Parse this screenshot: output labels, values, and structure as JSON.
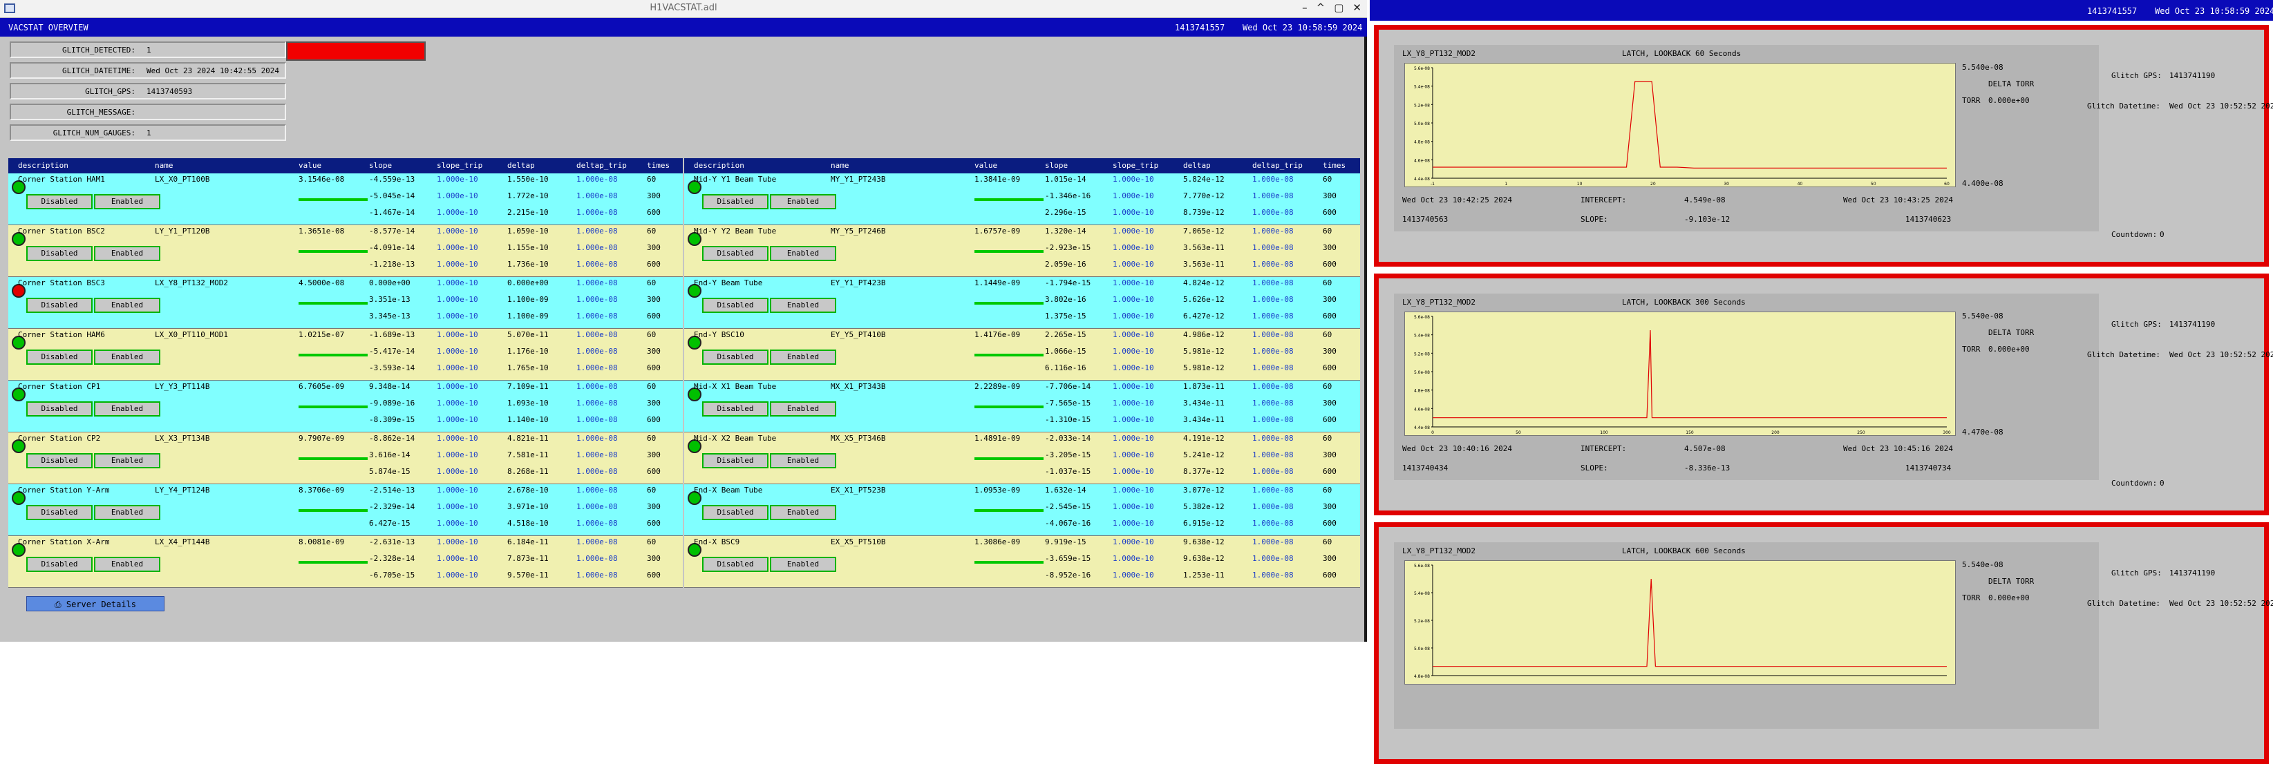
{
  "window": {
    "title": "H1VACSTAT.adl",
    "controls": [
      "–",
      "^",
      "▢",
      "✕"
    ]
  },
  "header": {
    "title": "VACSTAT OVERVIEW",
    "gps": "1413741557",
    "datetime": "Wed Oct 23 10:58:59 2024"
  },
  "right_header": {
    "gps": "1413741557",
    "datetime": "Wed Oct 23 10:58:59 2024"
  },
  "glitch": {
    "detected_label": "GLITCH_DETECTED:",
    "detected_value": "1",
    "datetime_label": "GLITCH_DATETIME:",
    "datetime_value": "Wed Oct 23 2024 10:42:55 2024",
    "gps_label": "GLITCH_GPS:",
    "gps_value": "1413740593",
    "message_label": "GLITCH_MESSAGE:",
    "message_value": "",
    "num_gauges_label": "GLITCH_NUM_GAUGES:",
    "num_gauges_value": "1"
  },
  "columns": [
    "description",
    "name",
    "value",
    "slope",
    "slope_trip",
    "deltap",
    "deltap_trip",
    "times"
  ],
  "buttons": {
    "disabled": "Disabled",
    "enabled": "Enabled"
  },
  "status_colors": {
    "ok": "#00c000",
    "alarm": "#e00000"
  },
  "left_rows": [
    {
      "description": "Corner Station HAM1",
      "name": "LX_X0_PT100B",
      "value": "3.1546e-08",
      "status": "ok",
      "bg": "#80ffff",
      "slope": [
        "-4.559e-13",
        "-5.045e-14",
        "-1.467e-14"
      ],
      "slope_trip": [
        "1.000e-10",
        "1.000e-10",
        "1.000e-10"
      ],
      "deltap": [
        "1.550e-10",
        "1.772e-10",
        "2.215e-10"
      ],
      "deltap_trip": [
        "1.000e-08",
        "1.000e-08",
        "1.000e-08"
      ],
      "times": [
        "60",
        "300",
        "600"
      ]
    },
    {
      "description": "Corner Station BSC2",
      "name": "LY_Y1_PT120B",
      "value": "1.3651e-08",
      "status": "ok",
      "bg": "#f0f0b0",
      "slope": [
        "-8.577e-14",
        "-4.091e-14",
        "-1.218e-13"
      ],
      "slope_trip": [
        "1.000e-10",
        "1.000e-10",
        "1.000e-10"
      ],
      "deltap": [
        "1.059e-10",
        "1.155e-10",
        "1.736e-10"
      ],
      "deltap_trip": [
        "1.000e-08",
        "1.000e-08",
        "1.000e-08"
      ],
      "times": [
        "60",
        "300",
        "600"
      ]
    },
    {
      "description": "Corner Station BSC3",
      "name": "LX_Y8_PT132_MOD2",
      "value": "4.5000e-08",
      "status": "alarm",
      "bg": "#80ffff",
      "slope": [
        "0.000e+00",
        "3.351e-13",
        "3.345e-13"
      ],
      "slope_trip": [
        "1.000e-10",
        "1.000e-10",
        "1.000e-10"
      ],
      "deltap": [
        "0.000e+00",
        "1.100e-09",
        "1.100e-09"
      ],
      "deltap_trip": [
        "1.000e-08",
        "1.000e-08",
        "1.000e-08"
      ],
      "times": [
        "60",
        "300",
        "600"
      ]
    },
    {
      "description": "Corner Station HAM6",
      "name": "LX_X0_PT110_MOD1",
      "value": "1.0215e-07",
      "status": "ok",
      "bg": "#f0f0b0",
      "slope": [
        "-1.689e-13",
        "-5.417e-14",
        "-3.593e-14"
      ],
      "slope_trip": [
        "1.000e-10",
        "1.000e-10",
        "1.000e-10"
      ],
      "deltap": [
        "5.070e-11",
        "1.176e-10",
        "1.765e-10"
      ],
      "deltap_trip": [
        "1.000e-08",
        "1.000e-08",
        "1.000e-08"
      ],
      "times": [
        "60",
        "300",
        "600"
      ]
    },
    {
      "description": "Corner Station CP1",
      "name": "LY_Y3_PT114B",
      "value": "6.7605e-09",
      "status": "ok",
      "bg": "#80ffff",
      "slope": [
        "9.348e-14",
        "-9.089e-16",
        "-8.309e-15"
      ],
      "slope_trip": [
        "1.000e-10",
        "1.000e-10",
        "1.000e-10"
      ],
      "deltap": [
        "7.109e-11",
        "1.093e-10",
        "1.140e-10"
      ],
      "deltap_trip": [
        "1.000e-08",
        "1.000e-08",
        "1.000e-08"
      ],
      "times": [
        "60",
        "300",
        "600"
      ]
    },
    {
      "description": "Corner Station CP2",
      "name": "LX_X3_PT134B",
      "value": "9.7907e-09",
      "status": "ok",
      "bg": "#f0f0b0",
      "slope": [
        "-8.862e-14",
        "3.616e-14",
        "5.874e-15"
      ],
      "slope_trip": [
        "1.000e-10",
        "1.000e-10",
        "1.000e-10"
      ],
      "deltap": [
        "4.821e-11",
        "7.581e-11",
        "8.268e-11"
      ],
      "deltap_trip": [
        "1.000e-08",
        "1.000e-08",
        "1.000e-08"
      ],
      "times": [
        "60",
        "300",
        "600"
      ]
    },
    {
      "description": "Corner Station Y-Arm",
      "name": "LY_Y4_PT124B",
      "value": "8.3706e-09",
      "status": "ok",
      "bg": "#80ffff",
      "slope": [
        "-2.514e-13",
        "-2.329e-14",
        "6.427e-15"
      ],
      "slope_trip": [
        "1.000e-10",
        "1.000e-10",
        "1.000e-10"
      ],
      "deltap": [
        "2.678e-10",
        "3.971e-10",
        "4.518e-10"
      ],
      "deltap_trip": [
        "1.000e-08",
        "1.000e-08",
        "1.000e-08"
      ],
      "times": [
        "60",
        "300",
        "600"
      ]
    },
    {
      "description": "Corner Station X-Arm",
      "name": "LX_X4_PT144B",
      "value": "8.0081e-09",
      "status": "ok",
      "bg": "#f0f0b0",
      "slope": [
        "-2.631e-13",
        "-2.328e-14",
        "-6.705e-15"
      ],
      "slope_trip": [
        "1.000e-10",
        "1.000e-10",
        "1.000e-10"
      ],
      "deltap": [
        "6.184e-11",
        "7.873e-11",
        "9.570e-11"
      ],
      "deltap_trip": [
        "1.000e-08",
        "1.000e-08",
        "1.000e-08"
      ],
      "times": [
        "60",
        "300",
        "600"
      ]
    }
  ],
  "right_rows": [
    {
      "description": "Mid-Y Y1 Beam Tube",
      "name": "MY_Y1_PT243B",
      "value": "1.3841e-09",
      "status": "ok",
      "bg": "#80ffff",
      "slope": [
        "1.015e-14",
        "-1.346e-16",
        "2.296e-15"
      ],
      "slope_trip": [
        "1.000e-10",
        "1.000e-10",
        "1.000e-10"
      ],
      "deltap": [
        "5.824e-12",
        "7.770e-12",
        "8.739e-12"
      ],
      "deltap_trip": [
        "1.000e-08",
        "1.000e-08",
        "1.000e-08"
      ],
      "times": [
        "60",
        "300",
        "600"
      ]
    },
    {
      "description": "Mid-Y Y2 Beam Tube",
      "name": "MY_Y5_PT246B",
      "value": "1.6757e-09",
      "status": "ok",
      "bg": "#f0f0b0",
      "slope": [
        "1.320e-14",
        "-2.923e-15",
        "2.059e-16"
      ],
      "slope_trip": [
        "1.000e-10",
        "1.000e-10",
        "1.000e-10"
      ],
      "deltap": [
        "7.065e-12",
        "3.563e-11",
        "3.563e-11"
      ],
      "deltap_trip": [
        "1.000e-08",
        "1.000e-08",
        "1.000e-08"
      ],
      "times": [
        "60",
        "300",
        "600"
      ]
    },
    {
      "description": "End-Y Beam Tube",
      "name": "EY_Y1_PT423B",
      "value": "1.1449e-09",
      "status": "ok",
      "bg": "#80ffff",
      "slope": [
        "-1.794e-15",
        "3.802e-16",
        "1.375e-15"
      ],
      "slope_trip": [
        "1.000e-10",
        "1.000e-10",
        "1.000e-10"
      ],
      "deltap": [
        "4.824e-12",
        "5.626e-12",
        "6.427e-12"
      ],
      "deltap_trip": [
        "1.000e-08",
        "1.000e-08",
        "1.000e-08"
      ],
      "times": [
        "60",
        "300",
        "600"
      ]
    },
    {
      "description": "End-Y BSC10",
      "name": "EY_Y5_PT410B",
      "value": "1.4176e-09",
      "status": "ok",
      "bg": "#f0f0b0",
      "slope": [
        "2.265e-15",
        "1.066e-15",
        "6.116e-16"
      ],
      "slope_trip": [
        "1.000e-10",
        "1.000e-10",
        "1.000e-10"
      ],
      "deltap": [
        "4.986e-12",
        "5.981e-12",
        "5.981e-12"
      ],
      "deltap_trip": [
        "1.000e-08",
        "1.000e-08",
        "1.000e-08"
      ],
      "times": [
        "60",
        "300",
        "600"
      ]
    },
    {
      "description": "Mid-X X1 Beam Tube",
      "name": "MX_X1_PT343B",
      "value": "2.2289e-09",
      "status": "ok",
      "bg": "#80ffff",
      "slope": [
        "-7.706e-14",
        "-7.565e-15",
        "-1.310e-15"
      ],
      "slope_trip": [
        "1.000e-10",
        "1.000e-10",
        "1.000e-10"
      ],
      "deltap": [
        "1.873e-11",
        "3.434e-11",
        "3.434e-11"
      ],
      "deltap_trip": [
        "1.000e-08",
        "1.000e-08",
        "1.000e-08"
      ],
      "times": [
        "60",
        "300",
        "600"
      ]
    },
    {
      "description": "Mid-X X2 Beam Tube",
      "name": "MX_X5_PT346B",
      "value": "1.4891e-09",
      "status": "ok",
      "bg": "#f0f0b0",
      "slope": [
        "-2.033e-14",
        "-3.205e-15",
        "-1.037e-15"
      ],
      "slope_trip": [
        "1.000e-10",
        "1.000e-10",
        "1.000e-10"
      ],
      "deltap": [
        "4.191e-12",
        "5.241e-12",
        "8.377e-12"
      ],
      "deltap_trip": [
        "1.000e-08",
        "1.000e-08",
        "1.000e-08"
      ],
      "times": [
        "60",
        "300",
        "600"
      ]
    },
    {
      "description": "End-X Beam Tube",
      "name": "EX_X1_PT523B",
      "value": "1.0953e-09",
      "status": "ok",
      "bg": "#80ffff",
      "slope": [
        "1.632e-14",
        "-2.545e-15",
        "-4.067e-16"
      ],
      "slope_trip": [
        "1.000e-10",
        "1.000e-10",
        "1.000e-10"
      ],
      "deltap": [
        "3.077e-12",
        "5.382e-12",
        "6.915e-12"
      ],
      "deltap_trip": [
        "1.000e-08",
        "1.000e-08",
        "1.000e-08"
      ],
      "times": [
        "60",
        "300",
        "600"
      ]
    },
    {
      "description": "End-X BSC9",
      "name": "EX_X5_PT510B",
      "value": "1.3086e-09",
      "status": "ok",
      "bg": "#f0f0b0",
      "slope": [
        "9.919e-15",
        "-3.659e-15",
        "-8.952e-16"
      ],
      "slope_trip": [
        "1.000e-10",
        "1.000e-10",
        "1.000e-10"
      ],
      "deltap": [
        "9.638e-12",
        "9.638e-12",
        "1.253e-11"
      ],
      "deltap_trip": [
        "1.000e-08",
        "1.000e-08",
        "1.000e-08"
      ],
      "times": [
        "60",
        "300",
        "600"
      ]
    }
  ],
  "server_button": "Server Details",
  "panels": [
    {
      "gauge": "LX_Y8_PT132_MOD2",
      "title": "LATCH, LOOKBACK 60 Seconds",
      "ymax": "5.540e-08",
      "ymin": "4.400e-08",
      "torr_label": "TORR",
      "delta_label": "DELTA TORR",
      "delta_value": "0.000e+00",
      "start_datetime": "Wed Oct 23 10:42:25 2024",
      "end_datetime": "Wed Oct 23 10:43:25 2024",
      "intercept_label": "INTERCEPT:",
      "intercept": "4.549e-08",
      "slope_label": "SLOPE:",
      "slope": "-9.103e-12",
      "start_gps": "1413740563",
      "end_gps": "1413740623",
      "glitch_gps_label": "Glitch GPS:",
      "glitch_gps": "1413741190",
      "glitch_datetime_label": "Glitch Datetime:",
      "glitch_datetime": "Wed Oct 23 10:52:52 2024",
      "countdown_label": "Countdown:",
      "countdown": "0",
      "ytick_labels": [
        "5.6e-08",
        "5.4e-08",
        "5.2e-08",
        "5.0e-08",
        "4.8e-08",
        "4.6e-08",
        "4.4e-08"
      ],
      "xtick_labels": [
        "-1",
        "1",
        "10",
        "20",
        "30",
        "40",
        "50",
        "60"
      ]
    },
    {
      "gauge": "LX_Y8_PT132_MOD2",
      "title": "LATCH, LOOKBACK 300 Seconds",
      "ymax": "5.540e-08",
      "ymin": "4.470e-08",
      "torr_label": "TORR",
      "delta_label": "DELTA TORR",
      "delta_value": "0.000e+00",
      "start_datetime": "Wed Oct 23 10:40:16 2024",
      "end_datetime": "Wed Oct 23 10:45:16 2024",
      "intercept_label": "INTERCEPT:",
      "intercept": "4.507e-08",
      "slope_label": "SLOPE:",
      "slope": "-8.336e-13",
      "start_gps": "1413740434",
      "end_gps": "1413740734",
      "glitch_gps_label": "Glitch GPS:",
      "glitch_gps": "1413741190",
      "glitch_datetime_label": "Glitch Datetime:",
      "glitch_datetime": "Wed Oct 23 10:52:52 2024",
      "countdown_label": "Countdown:",
      "countdown": "0",
      "ytick_labels": [
        "5.6e-08",
        "5.4e-08",
        "5.2e-08",
        "5.0e-08",
        "4.8e-08",
        "4.6e-08",
        "4.4e-08"
      ],
      "xtick_labels": [
        "0",
        "50",
        "100",
        "150",
        "200",
        "250",
        "300"
      ]
    },
    {
      "gauge": "LX_Y8_PT132_MOD2",
      "title": "LATCH, LOOKBACK 600 Seconds",
      "ymax": "5.540e-08",
      "ymin": "",
      "torr_label": "TORR",
      "delta_label": "DELTA TORR",
      "delta_value": "0.000e+00",
      "start_datetime": "",
      "end_datetime": "",
      "intercept_label": "",
      "intercept": "",
      "slope_label": "",
      "slope": "",
      "start_gps": "",
      "end_gps": "",
      "glitch_gps_label": "Glitch GPS:",
      "glitch_gps": "1413741190",
      "glitch_datetime_label": "Glitch Datetime:",
      "glitch_datetime": "Wed Oct 23 10:52:52 2024",
      "countdown_label": "",
      "countdown": "",
      "ytick_labels": [
        "5.6e-08",
        "5.4e-08",
        "5.2e-08",
        "5.0e-08",
        "4.8e-08"
      ],
      "xtick_labels": []
    }
  ],
  "chart_data": [
    {
      "type": "line",
      "title": "LATCH, LOOKBACK 60 Seconds",
      "xlim": [
        -1,
        60
      ],
      "ylim": [
        4.4e-08,
        5.6e-08
      ],
      "series": [
        {
          "x": [
            -1,
            20,
            22,
            23,
            25,
            26,
            28,
            30,
            40,
            50,
            60
          ],
          "values": [
            4.52e-08,
            4.52e-08,
            4.52e-08,
            5.45e-08,
            5.45e-08,
            4.52e-08,
            4.52e-08,
            4.51e-08,
            4.51e-08,
            4.51e-08,
            4.51e-08
          ]
        }
      ]
    },
    {
      "type": "line",
      "title": "LATCH, LOOKBACK 300 Seconds",
      "xlim": [
        0,
        300
      ],
      "ylim": [
        4.4e-08,
        5.6e-08
      ],
      "series": [
        {
          "x": [
            0,
            50,
            100,
            125,
            127,
            128,
            130,
            150,
            200,
            250,
            300
          ],
          "values": [
            4.5e-08,
            4.5e-08,
            4.5e-08,
            4.5e-08,
            5.45e-08,
            4.5e-08,
            4.5e-08,
            4.5e-08,
            4.5e-08,
            4.5e-08,
            4.5e-08
          ]
        }
      ]
    },
    {
      "type": "line",
      "title": "LATCH, LOOKBACK 600 Seconds",
      "xlim": [
        0,
        600
      ],
      "ylim": [
        4.4e-08,
        5.6e-08
      ],
      "series": [
        {
          "x": [
            0,
            250,
            255,
            260,
            600
          ],
          "values": [
            4.5e-08,
            4.5e-08,
            5.45e-08,
            4.5e-08,
            4.5e-08
          ]
        }
      ]
    }
  ]
}
